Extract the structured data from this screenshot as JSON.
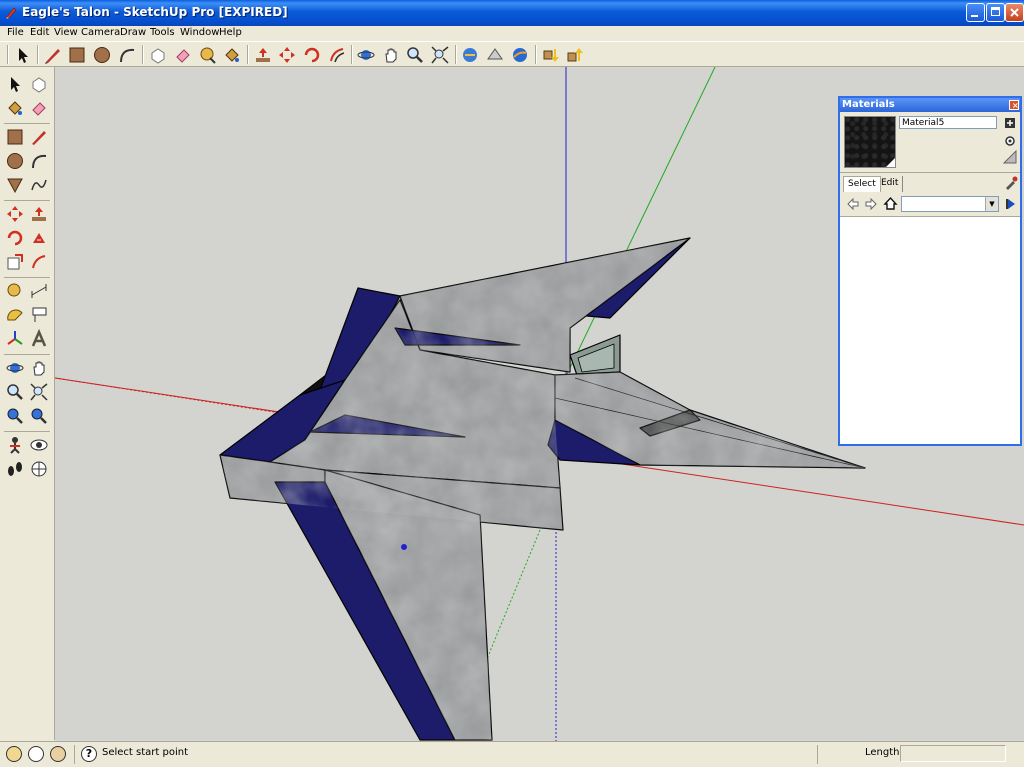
{
  "window": {
    "title": "Eagle's Talon - SketchUp Pro [EXPIRED]",
    "accent_color": "#0a5fe0"
  },
  "menu": {
    "items": [
      "File",
      "Edit",
      "View",
      "Camera",
      "Draw",
      "Tools",
      "Window",
      "Help"
    ]
  },
  "toolbar": {
    "icons": [
      "select-icon",
      "pencil-icon",
      "rectangle-icon",
      "circle-icon",
      "arc-icon",
      "make-component-icon",
      "eraser-icon",
      "tape-measure-icon",
      "paint-bucket-icon",
      "push-pull-icon",
      "move-icon",
      "rotate-icon",
      "offset-icon",
      "orbit-icon",
      "pan-icon",
      "zoom-icon",
      "zoom-extents-icon",
      "3d-warehouse-icon",
      "share-model-icon",
      "google-earth-icon",
      "get-models-icon",
      "share-component-icon"
    ]
  },
  "left_toolbar": {
    "icons": [
      "select-icon",
      "make-component-icon",
      "paint-bucket-icon",
      "eraser-icon",
      "rectangle-icon",
      "line-icon",
      "circle-icon",
      "arc-icon",
      "polygon-icon",
      "freehand-icon",
      "move-icon",
      "push-pull-icon",
      "rotate-icon",
      "follow-me-icon",
      "scale-icon",
      "offset-icon",
      "tape-measure-icon",
      "dimension-icon",
      "protractor-icon",
      "text-icon",
      "axes-icon",
      "3d-text-icon",
      "orbit-icon",
      "pan-icon",
      "zoom-icon",
      "zoom-window-icon",
      "previous-view-icon",
      "next-view-icon",
      "position-camera-icon",
      "look-around-icon",
      "walk-icon",
      "section-plane-icon"
    ]
  },
  "materials": {
    "title": "Materials",
    "material_name": "Material5",
    "tabs": [
      "Select",
      "Edit"
    ],
    "library_value": "",
    "swatch_color": "#141414"
  },
  "model": {
    "fill_color": "#9a9c9e",
    "accent_color": "#1c1c6a",
    "axis_red": "#cc2222",
    "axis_green": "#22aa22",
    "axis_blue": "#2222cc"
  },
  "status": {
    "text": "Select start point",
    "length_label": "Length",
    "length_value": ""
  }
}
